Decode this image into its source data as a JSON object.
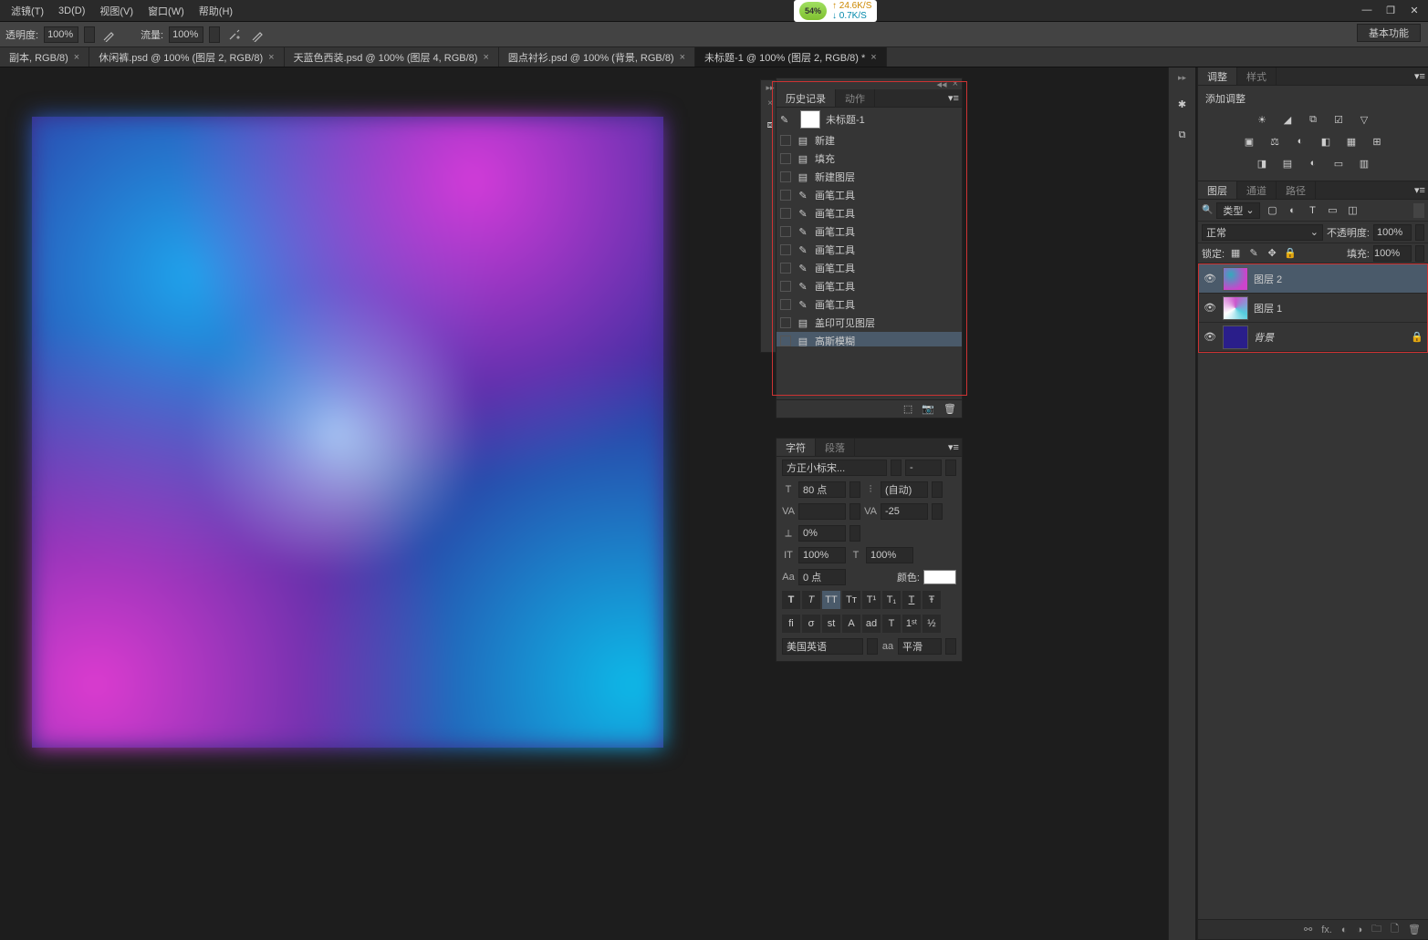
{
  "menu": {
    "items": [
      "滤镜(T)",
      "3D(D)",
      "视图(V)",
      "窗口(W)",
      "帮助(H)"
    ]
  },
  "netspeed": {
    "pct": "54%",
    "up": "↑ 24.6K/S",
    "down": "↓ 0.7K/S"
  },
  "options": {
    "opacity_label": "透明度:",
    "opacity_value": "100%",
    "flow_label": "流量:",
    "flow_value": "100%",
    "workspace": "基本功能"
  },
  "tabs": [
    {
      "label": "副本, RGB/8)"
    },
    {
      "label": "休闲裤.psd @ 100% (图层 2, RGB/8)"
    },
    {
      "label": "天蓝色西装.psd @ 100% (图层 4, RGB/8)"
    },
    {
      "label": "圆点衬衫.psd @ 100% (背景, RGB/8)"
    },
    {
      "label": "未标题-1 @ 100% (图层 2, RGB/8) *",
      "active": true
    }
  ],
  "adjust": {
    "tab1": "调整",
    "tab2": "样式",
    "title": "添加调整"
  },
  "layers_panel": {
    "tab1": "图层",
    "tab2": "通道",
    "tab3": "路径",
    "kind_label": "类型",
    "blend": "正常",
    "opacity_label": "不透明度:",
    "opacity": "100%",
    "lock_label": "锁定:",
    "fill_label": "填充:",
    "fill": "100%",
    "layers": [
      {
        "name": "图层 2"
      },
      {
        "name": "图层 1"
      },
      {
        "name": "背景",
        "locked": true
      }
    ]
  },
  "history": {
    "tab1": "历史记录",
    "tab2": "动作",
    "doc": "未标题-1",
    "items": [
      {
        "icon": "doc",
        "label": "新建"
      },
      {
        "icon": "doc",
        "label": "填充"
      },
      {
        "icon": "doc",
        "label": "新建图层"
      },
      {
        "icon": "brush",
        "label": "画笔工具"
      },
      {
        "icon": "brush",
        "label": "画笔工具"
      },
      {
        "icon": "brush",
        "label": "画笔工具"
      },
      {
        "icon": "brush",
        "label": "画笔工具"
      },
      {
        "icon": "brush",
        "label": "画笔工具"
      },
      {
        "icon": "brush",
        "label": "画笔工具"
      },
      {
        "icon": "brush",
        "label": "画笔工具"
      },
      {
        "icon": "doc",
        "label": "盖印可见图层"
      },
      {
        "icon": "doc",
        "label": "高斯模糊",
        "selected": true
      }
    ]
  },
  "character": {
    "tab1": "字符",
    "tab2": "段落",
    "font": "方正小标宋...",
    "style": "-",
    "size": "80 点",
    "leading": "(自动)",
    "kerning": "",
    "tracking": "-25",
    "shift": "0%",
    "hscale": "100%",
    "vscale": "100%",
    "baseline": "0 点",
    "color_label": "颜色:",
    "lang": "美国英语",
    "aa": "平滑"
  }
}
